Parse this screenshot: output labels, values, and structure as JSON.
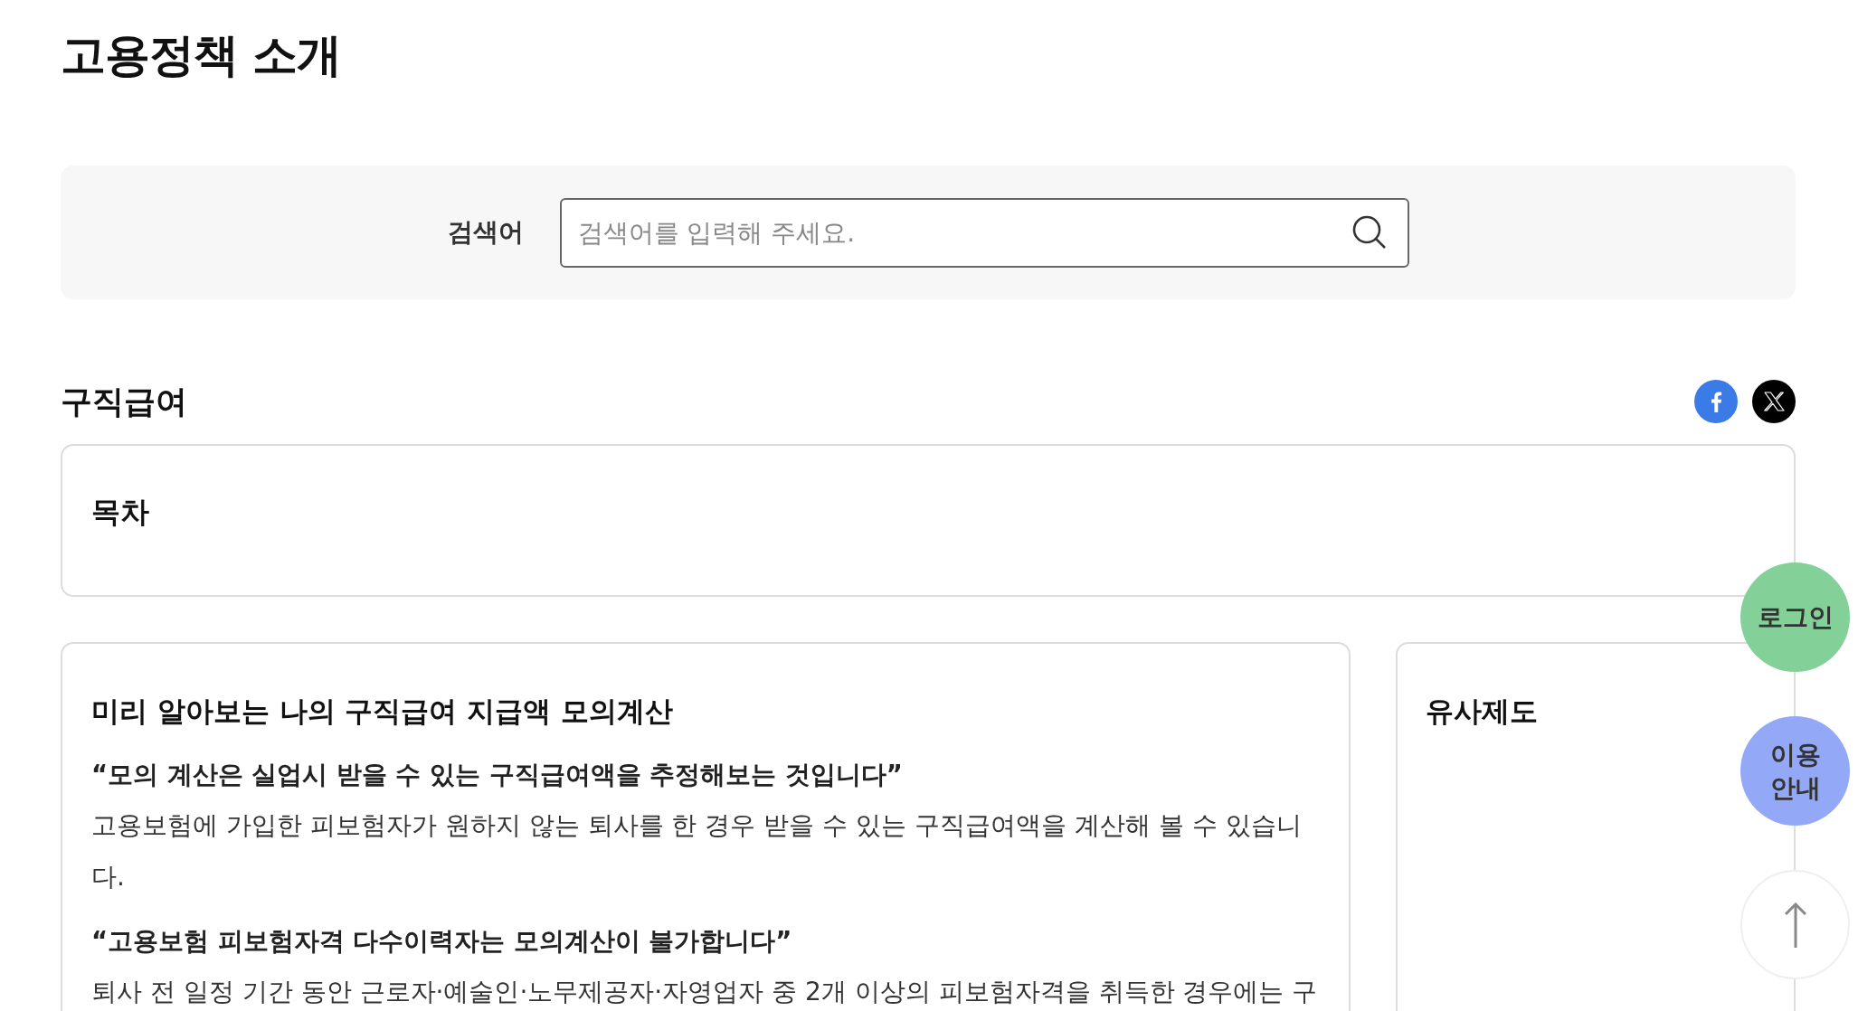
{
  "page": {
    "title": "고용정책 소개"
  },
  "search": {
    "label": "검색어",
    "placeholder": "검색어를 입력해 주세요."
  },
  "section": {
    "title": "구직급여",
    "share": [
      {
        "kind": "facebook"
      },
      {
        "kind": "x"
      }
    ]
  },
  "toc": {
    "title": "목차"
  },
  "main_card": {
    "title": "미리 알아보는 나의 구직급여 지급액 모의계산",
    "blocks": [
      {
        "kind": "quote",
        "text": "“모의 계산은 실업시 받을 수 있는 구직급여액을 추정해보는 것입니다”"
      },
      {
        "kind": "paragraph",
        "text": "고용보험에 가입한 피보험자가 원하지 않는 퇴사를 한 경우 받을 수 있는 구직급여액을 계산해 볼 수 있습니다."
      },
      {
        "kind": "quote",
        "text": "“고용보험 피보험자격 다수이력자는 모의계산이 불가합니다”"
      },
      {
        "kind": "paragraph",
        "text": "퇴사 전 일정 기간 동안 근로자·예술인·노무제공자·자영업자 중 2개 이상의 피보험자격을 취득한 경우에는 구"
      }
    ]
  },
  "side_card": {
    "title": "유사제도"
  },
  "floating": [
    {
      "kind": "login",
      "label": "로그인",
      "color": "#83d198"
    },
    {
      "kind": "guide",
      "label": "이용 안내",
      "color": "#93a9f7"
    },
    {
      "kind": "top"
    }
  ]
}
